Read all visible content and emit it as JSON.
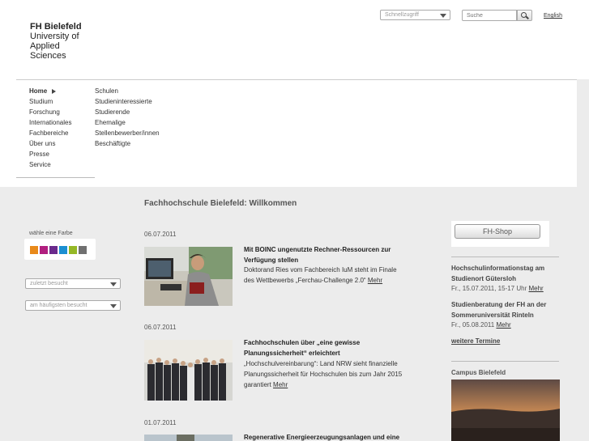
{
  "header": {
    "logo": {
      "line1": "FH Bielefeld",
      "line2": "University of",
      "line3": "Applied Sciences"
    },
    "quick_access": {
      "value": "Schnellzugriff",
      "icon": "chevron-down-icon"
    },
    "search": {
      "placeholder": "Suche",
      "icon": "search-icon"
    },
    "language_link": "English"
  },
  "nav": {
    "primary": [
      {
        "label": "Home",
        "active": true
      },
      {
        "label": "Studium"
      },
      {
        "label": "Forschung"
      },
      {
        "label": "Internationales"
      },
      {
        "label": "Fachbereiche"
      },
      {
        "label": "Über uns"
      },
      {
        "label": "Presse"
      },
      {
        "label": "Service"
      }
    ],
    "secondary": [
      {
        "label": "Schulen"
      },
      {
        "label": "Studieninteressierte"
      },
      {
        "label": "Studierende"
      },
      {
        "label": "Ehemalige"
      },
      {
        "label": "Stellenbewerber/innen"
      },
      {
        "label": "Beschäftigte"
      }
    ]
  },
  "main": {
    "title": "Fachhochschule Bielefeld: Willkommen",
    "news": [
      {
        "date": "06.07.2011",
        "title": "Mit BOINC ungenutzte Rechner-Ressourcen zur Verfügung stellen",
        "text": "Doktorand Ries vom Fachbereich IuM steht im Finale des Wettbewerbs „Ferchau-Challenge 2.0“",
        "more": "Mehr"
      },
      {
        "date": "06.07.2011",
        "title": "Fachhochschulen über „eine gewisse Planungssicherheit“ erleichtert",
        "text": "„Hochschulvereinbarung“: Land NRW sieht finanzielle Planungssicherheit für Hochschulen bis zum Jahr 2015 garantiert",
        "more": "Mehr"
      },
      {
        "date": "01.07.2011",
        "title": "Regenerative Energieerzeugungsanlagen und eine"
      }
    ]
  },
  "left": {
    "color_label": "wähle eine Farbe",
    "colors": [
      "#e8891a",
      "#b11f7f",
      "#6a2a8c",
      "#1c8fd1",
      "#95b826",
      "#707070"
    ],
    "recent_select": "zuletzt besucht",
    "frequent_select": "am häufigsten besucht"
  },
  "right": {
    "shop_label": "FH-Shop",
    "events": [
      {
        "title": "Hochschulinformationstag am Studienort Gütersloh",
        "date": "Fr., 15.07.2011, 15-17 Uhr",
        "more": "Mehr"
      },
      {
        "title": "Studienberatung der FH an der Sommeruniversität Rinteln",
        "date": "Fr., 05.08.2011",
        "more": "Mehr"
      }
    ],
    "more_dates": "weitere Termine",
    "campus_title": "Campus Bielefeld"
  }
}
